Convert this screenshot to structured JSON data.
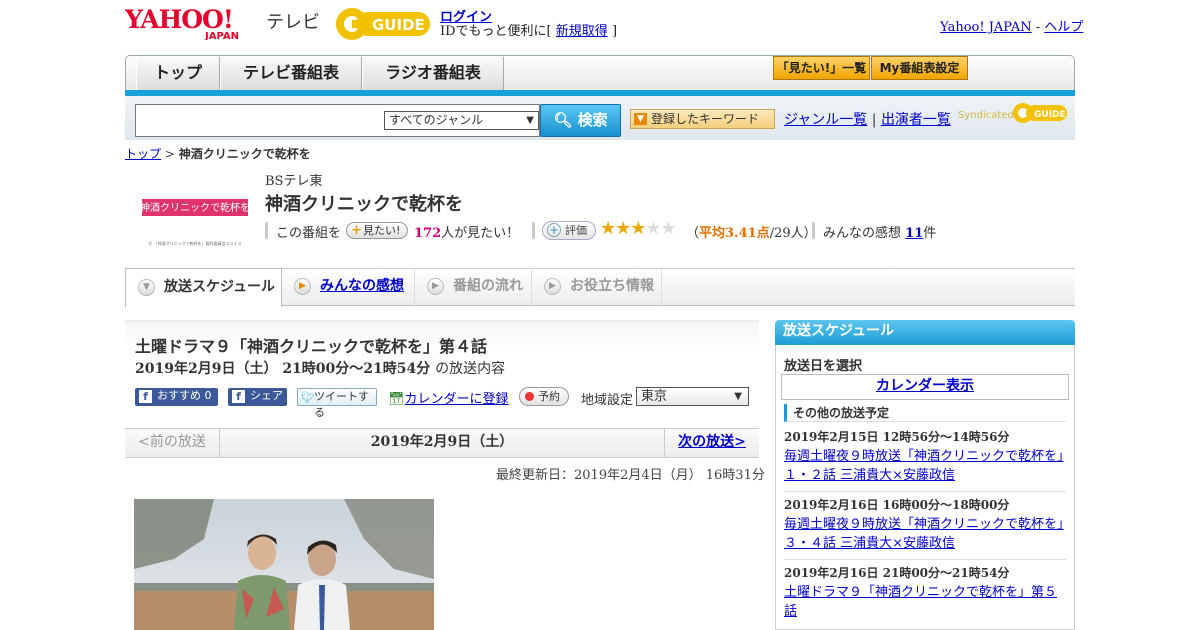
{
  "header": {
    "logo_yahoo": "YAHOO! JAPAN",
    "logo_tv": "テレビ",
    "logo_gguide": "G GUIDE",
    "login": "ログイン",
    "login_prompt_prefix": "IDでもっと便利に[",
    "signup": "新規取得",
    "login_prompt_suffix": "]",
    "yahoo_japan": "Yahoo! JAPAN",
    "sep": "-",
    "help": "ヘルプ"
  },
  "nav": {
    "tabs": [
      "トップ",
      "テレビ番組表",
      "ラジオ番組表"
    ],
    "mitai_list": "「見たい!」一覧",
    "my_schedule": "My番組表設定"
  },
  "search": {
    "input_value": "",
    "genre": "すべてのジャンル",
    "button": "検索",
    "registered_keywords": "登録したキーワード",
    "genre_list": "ジャンル一覧",
    "divider": "|",
    "cast_list": "出演者一覧",
    "syndicated": "Syndicated"
  },
  "breadcrumb": {
    "top": "トップ",
    "sep": ">",
    "current": "神酒クリニックで乾杯を"
  },
  "program": {
    "thumb_text": "神酒クリニックで乾杯を",
    "thumb_caption": "© 「神酒クリニックで乾杯を」製作委員会２０１９",
    "channel": "BSテレ東",
    "title": "神酒クリニックで乾杯を",
    "this_program": "この番組を",
    "mitai_button": "見たい!",
    "mitai_count": "172",
    "mitai_suffix": "人が見たい！",
    "eval_button": "評価",
    "stars": "★★★★★",
    "rating_prefix": "（",
    "rating": "平均3.41点",
    "rating_suffix": "/29人）",
    "impressions_label": "みんなの感想",
    "impressions_count": "11",
    "impressions_suffix": "件"
  },
  "subtabs": {
    "schedule": "放送スケジュール",
    "comments": "みんなの感想",
    "flow": "番組の流れ",
    "info": "お役立ち情報"
  },
  "episode": {
    "title": "土曜ドラマ９「神酒クリニックで乾杯を」第４話",
    "date": "2019年2月9日（土） 21時00分～21時54分",
    "date_suffix": "の放送内容",
    "recommend": "おすすめ 0",
    "share": "シェア",
    "tweet": "ツイートする",
    "calendar": "カレンダーに登録",
    "reserve": "予約",
    "region_label": "地域設定",
    "region": "東京",
    "prev": "<前の放送",
    "pager_date": "2019年2月9日（土）",
    "next": "次の放送>",
    "last_updated": "最終更新日：2019年2月4日（月） 16時31分"
  },
  "sidebar": {
    "header": "放送スケジュール",
    "select_day": "放送日を選択",
    "calendar": "カレンダー表示",
    "other_head": "その他の放送予定",
    "items": [
      {
        "time": "2019年2月15日 12時56分～14時56分",
        "desc": "毎週土曜夜９時放送「神酒クリニックで乾杯を」１・２話 三浦貴大×安藤政信"
      },
      {
        "time": "2019年2月16日 16時00分～18時00分",
        "desc": "毎週土曜夜９時放送「神酒クリニックで乾杯を」３・４話 三浦貴大×安藤政信"
      },
      {
        "time": "2019年2月16日 21時00分～21時54分",
        "desc": "土曜ドラマ９「神酒クリニックで乾杯を」第５話"
      }
    ]
  },
  "colors": {
    "accent_blue": "#1aa0d8",
    "star_gold": "#e8a800",
    "link": "#0000cc",
    "rating_orange": "#e07000",
    "count_pink": "#d6007a"
  }
}
